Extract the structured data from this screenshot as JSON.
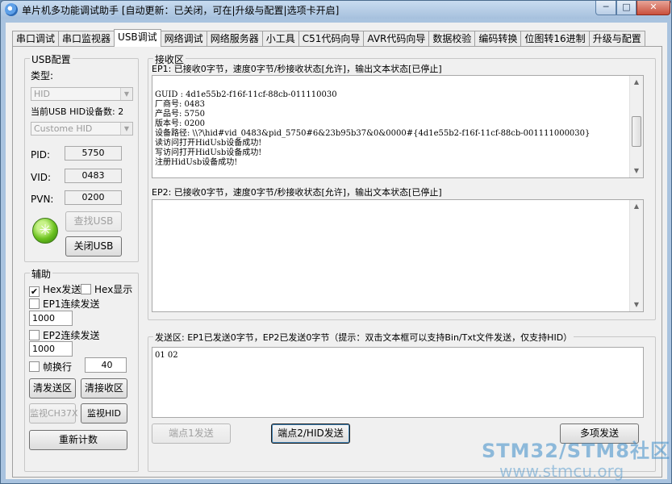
{
  "window": {
    "title": "单片机多功能调试助手 [自动更新：已关闭，可在|升级与配置|选项卡开启]",
    "min_glyph": "─",
    "max_glyph": "□",
    "close_glyph": "✕"
  },
  "tabs": [
    "串口调试",
    "串口监视器",
    "USB调试",
    "网络调试",
    "网络服务器",
    "小工具",
    "C51代码向导",
    "AVR代码向导",
    "数据校验",
    "编码转换",
    "位图转16进制",
    "升级与配置"
  ],
  "active_tab": "USB调试",
  "usb_config": {
    "group_title": "USB配置",
    "type_label": "类型:",
    "type_value": "HID",
    "device_count_label": "当前USB HID设备数: 2",
    "device_value": "Custome HID",
    "pid_label": "PID:",
    "pid_value": "5750",
    "vid_label": "VID:",
    "vid_value": "0483",
    "pvn_label": "PVN:",
    "pvn_value": "0200",
    "find_button": "查找USB",
    "close_button": "关闭USB",
    "green_icon_glyph": "✳"
  },
  "assist": {
    "group_title": "辅助",
    "hex_send_label": "Hex发送",
    "hex_send_checked": true,
    "hex_display_label": "Hex显示",
    "hex_display_checked": false,
    "ep1_continuous_label": "EP1连续发送",
    "ep1_interval": "1000",
    "ep2_continuous_label": "EP2连续发送",
    "ep2_interval": "1000",
    "frame_newline_label": "帧换行",
    "frame_newline_value": "40",
    "clear_send_button": "清发送区",
    "clear_recv_button": "清接收区",
    "monitor_ch37x_button": "监视CH37X",
    "monitor_hid_button": "监视HID",
    "recount_button": "重新计数",
    "check_mark": "✔"
  },
  "receive": {
    "group_title": "接收区",
    "ep1_status": "EP1: 已接收0字节，速度0字节/秒接收状态[允许]，输出文本状态[已停止]",
    "ep1_lines": [
      "",
      "GUID : 4d1e55b2-f16f-11cf-88cb-011110030",
      "厂商号: 0483",
      "产品号: 5750",
      "版本号: 0200",
      "设备路径: \\\\?\\hid#vid_0483&pid_5750#6&23b95b37&0&0000#{4d1e55b2-f16f-11cf-88cb-001111000030}",
      "读访问打开HidUsb设备成功!",
      "写访问打开HidUsb设备成功!",
      "注册HidUsb设备成功!"
    ],
    "ep2_status": "EP2: 已接收0字节，速度0字节/秒接收状态[允许]，输出文本状态[已停止]",
    "scroll_up_glyph": "▲",
    "scroll_down_glyph": "▼"
  },
  "send": {
    "group_title": "发送区: EP1已发送0字节，EP2已发送0字节（提示：双击文本框可以支持Bin/Txt文件发送，仅支持HID）",
    "content": "01 02",
    "ep1_send_button": "端点1发送",
    "ep2_send_button": "端点2/HID发送",
    "multi_send_button": "多项发送"
  },
  "watermark": {
    "line1": "STM32/STM8社区",
    "line2": "www.stmcu.org"
  }
}
